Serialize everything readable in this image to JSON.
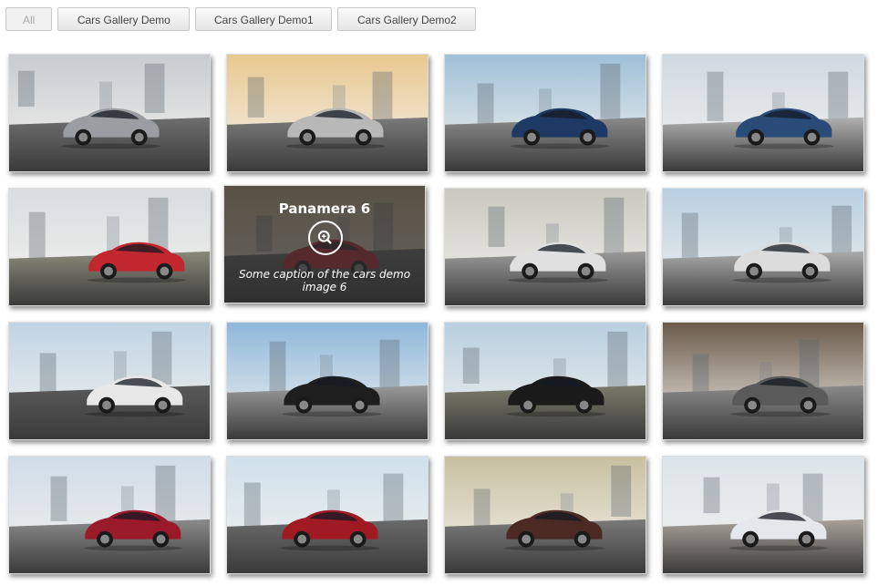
{
  "filters": [
    {
      "label": "All",
      "active": true
    },
    {
      "label": "Cars Gallery Demo",
      "active": false
    },
    {
      "label": "Cars Gallery Demo1",
      "active": false
    },
    {
      "label": "Cars Gallery Demo2",
      "active": false
    }
  ],
  "hovered_item": {
    "title": "Panamera 6",
    "caption": "Some caption of the cars demo image 6"
  },
  "thumbnails": [
    {
      "car_color": "#9a9ea3",
      "sky": "#c8ccd0",
      "ground": "#6e6e6e",
      "scene": "city-motion"
    },
    {
      "car_color": "#b8b8b8",
      "sky": "#e8c890",
      "ground": "#7a7a7a",
      "scene": "city-road"
    },
    {
      "car_color": "#1e3a64",
      "sky": "#9fc0d8",
      "ground": "#8a8a8a",
      "scene": "city-plaza"
    },
    {
      "car_color": "#2a4a78",
      "sky": "#cfd9e2",
      "ground": "#b0b0b0",
      "scene": "museum"
    },
    {
      "car_color": "#c2262e",
      "sky": "#d8dde0",
      "ground": "#8a8a7a",
      "scene": "parking-deck"
    },
    {
      "car_color": "#c2262e",
      "sky": "#d0b080",
      "ground": "#6a6a6a",
      "scene": "sunset-road"
    },
    {
      "car_color": "#e0e0e0",
      "sky": "#c8c8c0",
      "ground": "#9a9a9a",
      "scene": "garage"
    },
    {
      "car_color": "#dcdcdc",
      "sky": "#b8cfe0",
      "ground": "#aaaaaa",
      "scene": "skyline"
    },
    {
      "car_color": "#e8e8e8",
      "sky": "#c0d4e4",
      "ground": "#5a5a5a",
      "scene": "forest-road"
    },
    {
      "car_color": "#1e1e1e",
      "sky": "#8fb8dc",
      "ground": "#9a9a9a",
      "scene": "bridge"
    },
    {
      "car_color": "#1a1a1a",
      "sky": "#b8cfe0",
      "ground": "#7a7a6a",
      "scene": "country-road"
    },
    {
      "car_color": "#5a5a5a",
      "sky": "#6a5a4a",
      "ground": "#8a8a8a",
      "scene": "street-night"
    },
    {
      "car_color": "#9a1a2a",
      "sky": "#d0dce8",
      "ground": "#8a8a8a",
      "scene": "city-coast"
    },
    {
      "car_color": "#a01a24",
      "sky": "#cfe0ec",
      "ground": "#6a6a6a",
      "scene": "highway"
    },
    {
      "car_color": "#4a2a22",
      "sky": "#c8c0a0",
      "ground": "#7a7a7a",
      "scene": "motion-blur"
    },
    {
      "car_color": "#e4e8ec",
      "sky": "#dce4ea",
      "ground": "#a8a29a",
      "scene": "pier"
    }
  ]
}
